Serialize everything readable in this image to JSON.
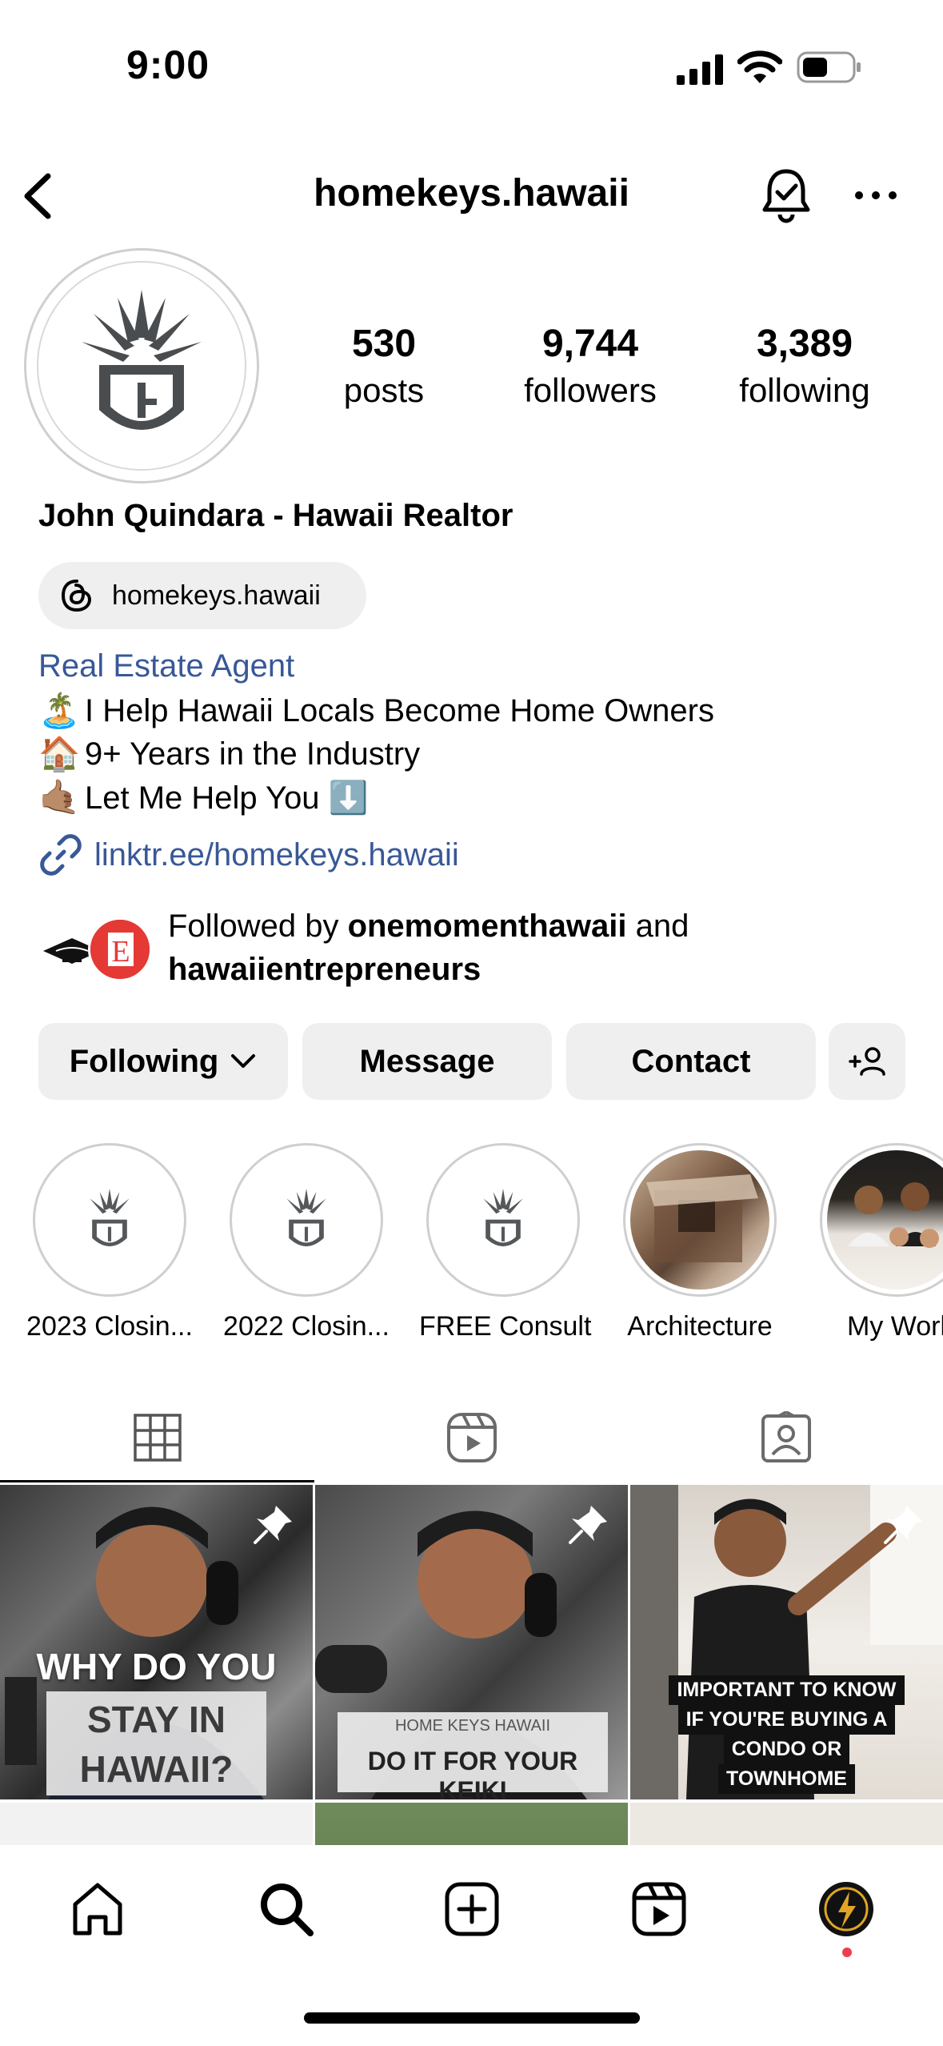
{
  "status_bar": {
    "time": "9:00"
  },
  "header": {
    "username": "homekeys.hawaii"
  },
  "profile": {
    "stats": [
      {
        "value": "530",
        "label": "posts"
      },
      {
        "value": "9,744",
        "label": "followers"
      },
      {
        "value": "3,389",
        "label": "following"
      }
    ],
    "full_name": "John Quindara - Hawaii Realtor",
    "threads_handle": "homekeys.hawaii",
    "category": "Real Estate Agent",
    "bio": [
      {
        "emoji": "🏝️",
        "text": "I Help Hawaii Locals Become Home Owners"
      },
      {
        "emoji": "🏠",
        "text": "9+ Years in the Industry"
      },
      {
        "emoji": "🤙🏽",
        "text": "Let Me Help You ⬇️"
      }
    ],
    "link": "linktr.ee/homekeys.hawaii",
    "followed_by": {
      "prefix": "Followed by ",
      "user1": "onemomenthawaii",
      "joiner": " and",
      "user2": "hawaiientrepreneurs"
    }
  },
  "actions": {
    "following": "Following",
    "message": "Message",
    "contact": "Contact"
  },
  "highlights": [
    {
      "label": "2023 Closin..."
    },
    {
      "label": "2022 Closin..."
    },
    {
      "label": "FREE Consult"
    },
    {
      "label": "Architecture"
    },
    {
      "label": "My Worl"
    }
  ],
  "posts": [
    {
      "line1": "WHY DO YOU",
      "line2": "STAY IN",
      "line3": "HAWAII?"
    },
    {
      "brand": "HOME KEYS HAWAII",
      "line1": "DO IT FOR YOUR KEIKI"
    },
    {
      "line1": "IMPORTANT TO KNOW",
      "line2": "IF YOU'RE BUYING A",
      "line3": "CONDO OR",
      "line4": "TOWNHOME"
    }
  ],
  "icons": {
    "back": "chevron-left-icon",
    "bell": "bell-icon",
    "more": "more-icon",
    "threads": "threads-icon",
    "link": "link-icon",
    "grid": "grid-icon",
    "reels": "reels-icon",
    "tagged": "tagged-icon",
    "home": "home-icon",
    "search": "search-icon",
    "create": "create-icon",
    "reels_nav": "reels-icon",
    "profile": "profile-avatar"
  },
  "colors": {
    "link_blue": "#385898",
    "button_bg": "#efefef",
    "notification": "#ed3d4c"
  }
}
